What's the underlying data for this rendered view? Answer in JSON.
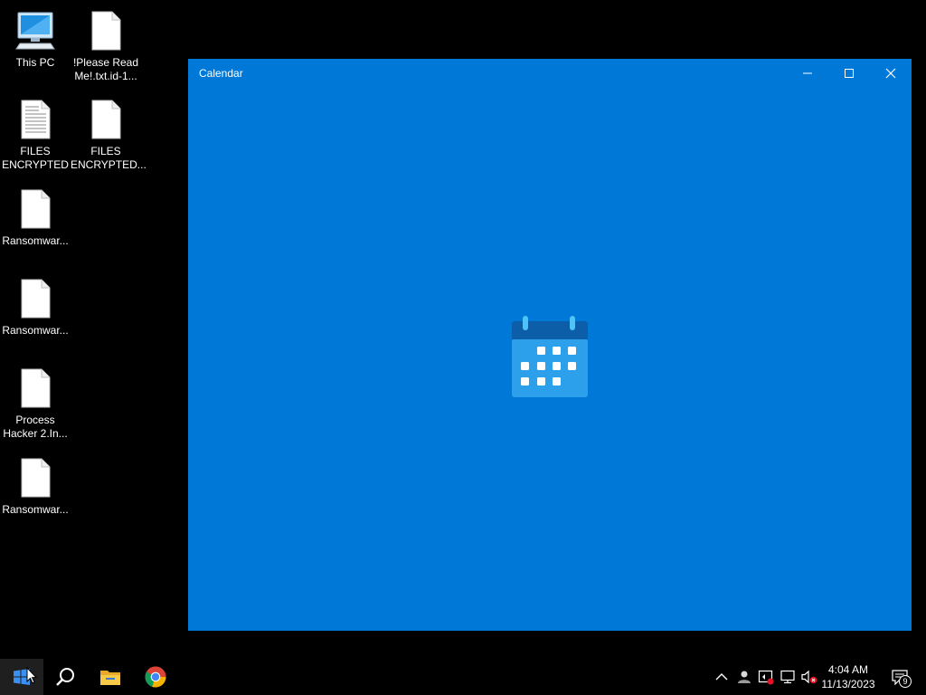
{
  "desktop": {
    "icons": [
      {
        "label": "This PC",
        "icon": "computer-icon"
      },
      {
        "label": "!Please Read Me!.txt.id-1...",
        "icon": "blank-file-icon"
      },
      {
        "label": "FILES ENCRYPTED",
        "icon": "text-document-icon"
      },
      {
        "label": "FILES ENCRYPTED...",
        "icon": "blank-file-icon"
      },
      {
        "label": "Ransomwar...",
        "icon": "blank-file-icon"
      },
      {
        "label": "Ransomwar...",
        "icon": "blank-file-icon"
      },
      {
        "label": "Process Hacker 2.In...",
        "icon": "blank-file-icon"
      },
      {
        "label": "Ransomwar...",
        "icon": "blank-file-icon"
      }
    ]
  },
  "window": {
    "title": "Calendar",
    "background": "#0078d7",
    "splash_icon": "calendar-icon"
  },
  "taskbar": {
    "start": "windows-start-icon",
    "pinned": [
      "search-icon",
      "file-explorer-icon",
      "chrome-icon"
    ],
    "tray": [
      "chevron-up-icon",
      "people-icon",
      "security-icon",
      "network-icon",
      "volume-muted-icon"
    ],
    "clock_time": "4:04 AM",
    "clock_date": "11/13/2023",
    "notification_count": "9"
  }
}
